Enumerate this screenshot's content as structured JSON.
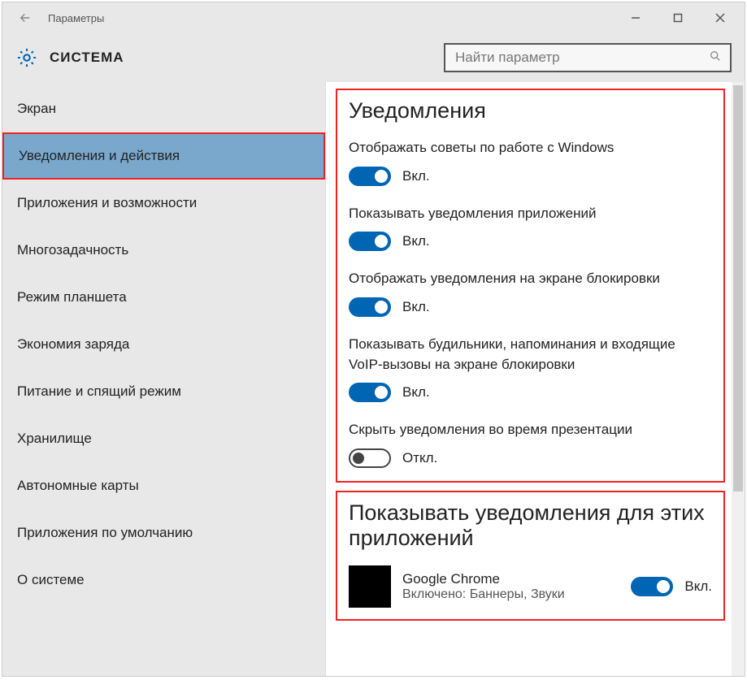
{
  "window": {
    "title": "Параметры"
  },
  "header": {
    "crumb": "СИСТЕМА",
    "search_placeholder": "Найти параметр"
  },
  "sidebar": {
    "items": [
      {
        "label": "Экран"
      },
      {
        "label": "Уведомления и действия",
        "active": true
      },
      {
        "label": "Приложения и возможности"
      },
      {
        "label": "Многозадачность"
      },
      {
        "label": "Режим планшета"
      },
      {
        "label": "Экономия заряда"
      },
      {
        "label": "Питание и спящий режим"
      },
      {
        "label": "Хранилище"
      },
      {
        "label": "Автономные карты"
      },
      {
        "label": "Приложения по умолчанию"
      },
      {
        "label": "О системе"
      }
    ]
  },
  "notifications": {
    "heading": "Уведомления",
    "state_on": "Вкл.",
    "state_off": "Откл.",
    "items": [
      {
        "label": "Отображать советы по работе с Windows",
        "on": true
      },
      {
        "label": "Показывать уведомления приложений",
        "on": true
      },
      {
        "label": "Отображать уведомления на экране блокировки",
        "on": true
      },
      {
        "label": "Показывать будильники, напоминания и входящие VoIP-вызовы на экране блокировки",
        "on": true
      },
      {
        "label": "Скрыть уведомления во время презентации",
        "on": false
      }
    ]
  },
  "apps": {
    "heading": "Показывать уведомления для этих приложений",
    "items": [
      {
        "name": "Google Chrome",
        "sub": "Включено: Баннеры, Звуки",
        "on": true
      }
    ]
  }
}
